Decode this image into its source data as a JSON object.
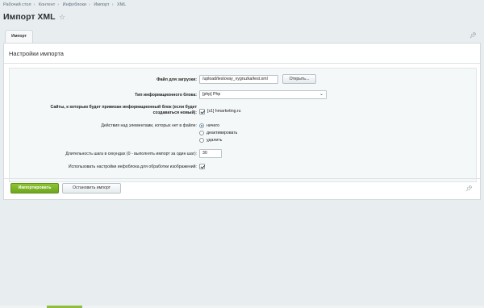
{
  "breadcrumbs": [
    "Рабочий стол",
    "Контент",
    "Инфоблоки",
    "Импорт",
    "XML"
  ],
  "page_title": "Импорт XML",
  "tabs": [
    {
      "label": "Импорт"
    }
  ],
  "panel": {
    "title": "Настройки импорта"
  },
  "form": {
    "file": {
      "label": "Файл для загрузки:",
      "value": "/upload/testovay_vygruzka/test.xml",
      "button": "Открыть..."
    },
    "iblock_type": {
      "label": "Тип информационного блока:",
      "value": "[php] Php"
    },
    "sites": {
      "label": "Сайты, к которым будет привязан информационный блок (если будет создаваться новый):",
      "value": "[s1] hmarketing.ru",
      "checked": true
    },
    "missing_action": {
      "label": "Действия над элементами, которых нет в файле:",
      "options": [
        {
          "label": "ничего",
          "selected": true
        },
        {
          "label": "деактивировать",
          "selected": false
        },
        {
          "label": "удалить",
          "selected": false
        }
      ]
    },
    "step": {
      "label": "Длительность шага в секундах (0 - выполнять импорт за один шаг):",
      "value": "30"
    },
    "image_settings": {
      "label": "Использовать настройки инфоблока для обработки изображений:",
      "checked": true
    }
  },
  "buttons": {
    "import": "Импортировать",
    "stop": "Остановить импорт"
  },
  "colors": {
    "accent": "#7ab12a",
    "background": "#e8edef",
    "link": "#5d7080"
  }
}
